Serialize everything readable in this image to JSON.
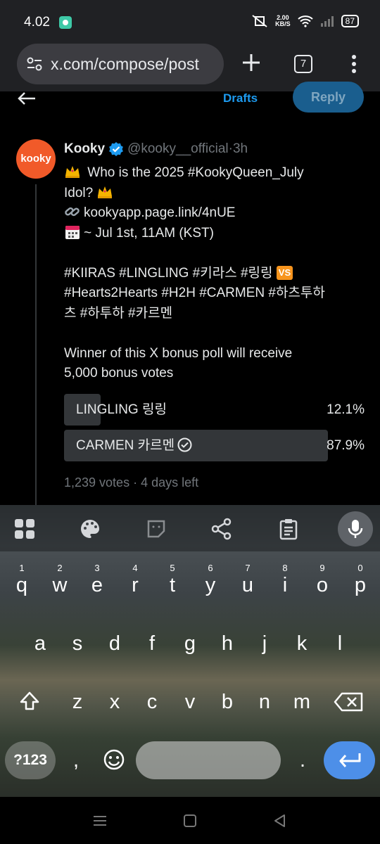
{
  "status_bar": {
    "time": "4.02",
    "net_speed_value": "2.00",
    "net_speed_unit": "KB/S",
    "battery": "87"
  },
  "browser": {
    "url": "x.com/compose/post",
    "tab_count": "7"
  },
  "compose_header": {
    "drafts_label": "Drafts",
    "reply_label": "Reply"
  },
  "tweet": {
    "avatar_text": "kooky",
    "name": "Kooky",
    "handle": "@kooky__official",
    "time_sep": " · ",
    "time": "3h",
    "lines": [
      " Who is the 2025 #KookyQueen_July",
      "Idol? ",
      "kookyapp.page.link/4nUE",
      "~ Jul 1st, 11AM (KST)",
      "#KIIRAS #LINGLING #키라스 #링링 ",
      "#Hearts2Hearts #H2H #CARMEN #하츠투하",
      "츠 #하투하 #카르멘",
      "Winner of this X bonus poll will receive",
      "5,000 bonus votes"
    ],
    "vs_badge": "VS",
    "poll": {
      "options": [
        {
          "label": "LINGLING 링링",
          "percent": "12.1%",
          "share": 12.1
        },
        {
          "label": "CARMEN 카르멘",
          "percent": "87.9%",
          "share": 87.9,
          "selected": true
        }
      ],
      "votes": "1,239 votes",
      "sep": " · ",
      "time_left": "4 days left"
    }
  },
  "keyboard": {
    "row1": [
      "q",
      "w",
      "e",
      "r",
      "t",
      "y",
      "u",
      "i",
      "o",
      "p"
    ],
    "row1_hints": [
      "1",
      "2",
      "3",
      "4",
      "5",
      "6",
      "7",
      "8",
      "9",
      "0"
    ],
    "row2": [
      "a",
      "s",
      "d",
      "f",
      "g",
      "h",
      "j",
      "k",
      "l"
    ],
    "row3": [
      "z",
      "x",
      "c",
      "v",
      "b",
      "n",
      "m"
    ],
    "symbols_label": "?123",
    "comma": ",",
    "period": "."
  },
  "colors": {
    "accent": "#1d9bf0",
    "brand": "#f15a29",
    "enter_key": "#4d8fe8"
  }
}
